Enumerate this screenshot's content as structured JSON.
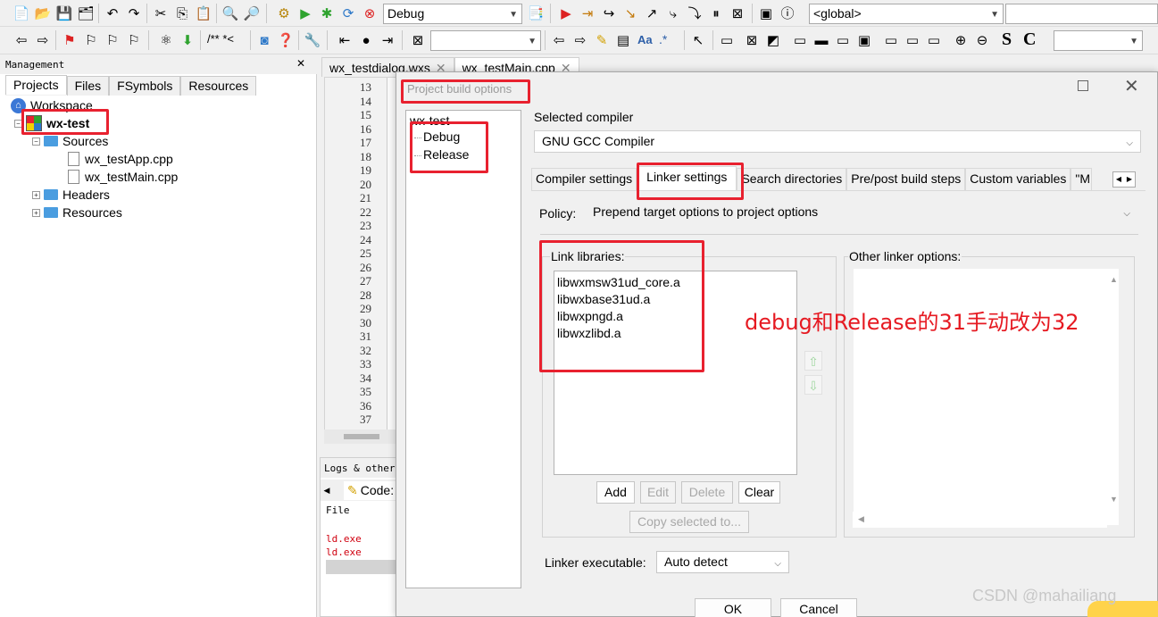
{
  "toolbar1": {
    "build_target": "Debug",
    "scope": "<global>"
  },
  "toolbar2": {
    "comment_tokens": "/** *<",
    "regex_label": "Aa",
    "regex_star": ".*",
    "letters": [
      "S",
      "C"
    ]
  },
  "management": {
    "title": "Management",
    "tabs": [
      "Projects",
      "Files",
      "FSymbols",
      "Resources"
    ],
    "tree": {
      "workspace": "Workspace",
      "project": "wx-test",
      "sources": "Sources",
      "files": [
        "wx_testApp.cpp",
        "wx_testMain.cpp"
      ],
      "headers": "Headers",
      "resources": "Resources"
    }
  },
  "editor": {
    "tabs": [
      "wx_testdialog.wxs",
      "wx_testMain.cpp"
    ],
    "line_numbers": [
      13,
      14,
      15,
      16,
      17,
      18,
      19,
      20,
      21,
      22,
      23,
      24,
      25,
      26,
      27,
      28,
      29,
      30,
      31,
      32,
      33,
      34,
      35,
      36,
      37
    ]
  },
  "logs": {
    "title": "Logs & others",
    "tab": "Code:",
    "column_file": "File",
    "rows": [
      "ld.exe",
      "ld.exe"
    ]
  },
  "dialog": {
    "title": "Project build options",
    "targets": {
      "project": "wx-test",
      "items": [
        "Debug",
        "Release"
      ]
    },
    "selected_compiler_label": "Selected compiler",
    "selected_compiler_value": "GNU GCC Compiler",
    "tabs": [
      "Compiler settings",
      "Linker settings",
      "Search directories",
      "Pre/post build steps",
      "Custom variables",
      "\"M"
    ],
    "active_tab": "Linker settings",
    "policy_label": "Policy:",
    "policy_value": "Prepend target options to project options",
    "link_libraries_label": "Link libraries:",
    "link_libraries": [
      "libwxmsw31ud_core.a",
      "libwxbase31ud.a",
      "libwxpngd.a",
      "libwxzlibd.a"
    ],
    "other_linker_label": "Other linker options:",
    "buttons": {
      "add": "Add",
      "edit": "Edit",
      "delete": "Delete",
      "clear": "Clear",
      "copy": "Copy selected to..."
    },
    "linker_exe_label": "Linker executable:",
    "linker_exe_value": "Auto detect",
    "ok": "OK",
    "cancel": "Cancel"
  },
  "annotation": "debug和Release的31手动改为32",
  "watermark": "CSDN @mahailiang",
  "colors": {
    "highlight_red": "#e8212f",
    "annotation_red": "#e61a22"
  }
}
